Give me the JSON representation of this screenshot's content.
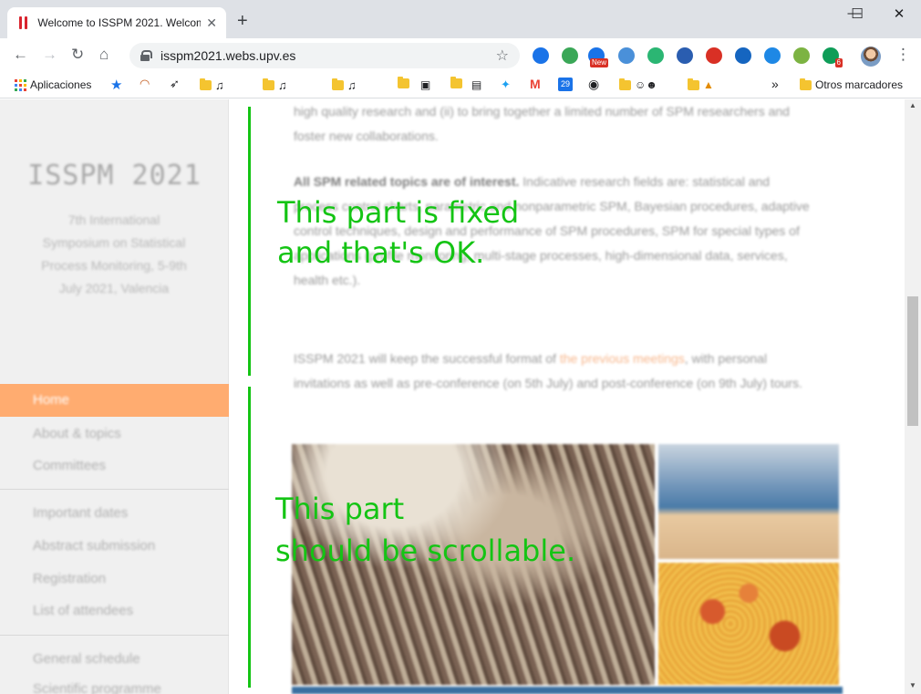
{
  "browser": {
    "tab_title": "Welcome to ISSPM 2021. Welcom",
    "new_tab_label": "+",
    "url": "isspm2021.webs.upv.es",
    "extensions": [
      {
        "name": "ext-blue",
        "color": "#1a73e8",
        "label": ""
      },
      {
        "name": "ext-green",
        "color": "#3aa757",
        "label": ""
      },
      {
        "name": "ext-new",
        "color": "#1a73e8",
        "label": "New"
      },
      {
        "name": "ext-window",
        "color": "#4a90d9",
        "label": ""
      },
      {
        "name": "ext-refresh",
        "color": "#2bb673",
        "label": ""
      },
      {
        "name": "ext-star",
        "color": "#2a5db0",
        "label": ""
      },
      {
        "name": "ext-shield",
        "color": "#d93025",
        "label": ""
      },
      {
        "name": "ext-target",
        "color": "#1565c0",
        "label": ""
      },
      {
        "name": "ext-book",
        "color": "#1e88e5",
        "label": ""
      },
      {
        "name": "ext-plant",
        "color": "#7cb342",
        "label": ""
      },
      {
        "name": "ext-badge",
        "color": "#0f9d58",
        "label": "6"
      }
    ]
  },
  "bookmarks": {
    "apps_label": "Aplicaciones",
    "chevron": "»",
    "other_label": "Otros marcadores",
    "icons": [
      "star-icon",
      "speedometer-icon",
      "rocket-icon",
      "music-folder",
      "guitar-folder",
      "radio-folder",
      "tv-icon",
      "window-icon",
      "twitter-icon",
      "gmail-icon",
      "calendar-icon",
      "info-icon",
      "smiley-folder",
      "ax-folder"
    ],
    "calendar_day": "29"
  },
  "sidebar": {
    "title": "ISSPM 2021",
    "subtitle": "7th International Symposium on Statistical Process Monitoring, 5-9th July 2021, Valencia",
    "nav_active": "Home",
    "nav_group1": [
      "About & topics",
      "Committees"
    ],
    "nav_group2": [
      "Important dates",
      "Abstract submission",
      "Registration",
      "List of attendees"
    ],
    "nav_group3": [
      "General schedule",
      "Scientific programme"
    ]
  },
  "content": {
    "p1": "high quality research and (ii) to bring together a limited number of SPM researchers and foster new collaborations.",
    "p2_bold": "All SPM related topics are of interest.",
    "p2_rest": " Indicative research fields are: statistical and process control charts, parametric and nonparametric SPM, Bayesian procedures, adaptive control techniques, design and performance of SPM procedures, SPM for special types of applications (profile monitoring, multi-stage processes, high-dimensional data, services, health etc.).",
    "p3_a": "ISSPM 2021 will keep the successful format of ",
    "p3_link": "the previous meetings",
    "p3_b": ", with personal invitations as well as pre-conference (on 5th July) and post-conference (on 9th July) tours."
  },
  "annotations": {
    "fixed_line1": "This part is fixed",
    "fixed_line2": "and that's OK.",
    "scroll_line1": "This part",
    "scroll_line2": "should be scrollable."
  },
  "colors": {
    "annotation": "#14c414",
    "nav_active": "#ffac70",
    "link": "#f7b78d"
  }
}
